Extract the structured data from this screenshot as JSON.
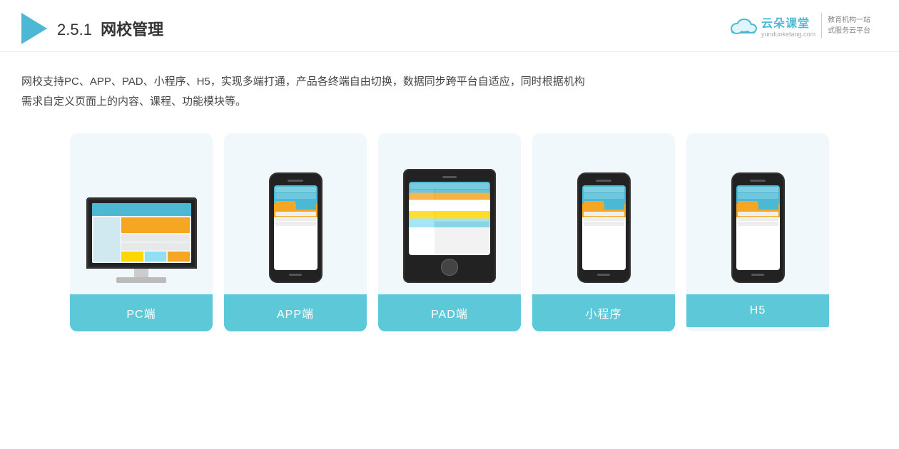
{
  "header": {
    "section_number": "2.5.1",
    "title_normal": "",
    "title_bold": "网校管理"
  },
  "brand": {
    "name_cn": "云朵课堂",
    "url": "yunduoketang.com",
    "slogan_line1": "教育机构一站",
    "slogan_line2": "式服务云平台"
  },
  "description": {
    "text_line1": "网校支持PC、APP、PAD、小程序、H5，实现多端打通，产品各终端自由切换，数据同步跨平台自适应，同时根据机构",
    "text_line2": "需求自定义页面上的内容、课程、功能模块等。"
  },
  "cards": [
    {
      "id": "pc",
      "label": "PC端",
      "type": "pc"
    },
    {
      "id": "app",
      "label": "APP端",
      "type": "phone"
    },
    {
      "id": "pad",
      "label": "PAD端",
      "type": "pad"
    },
    {
      "id": "miniapp",
      "label": "小程序",
      "type": "phone"
    },
    {
      "id": "h5",
      "label": "H5",
      "type": "phone"
    }
  ]
}
